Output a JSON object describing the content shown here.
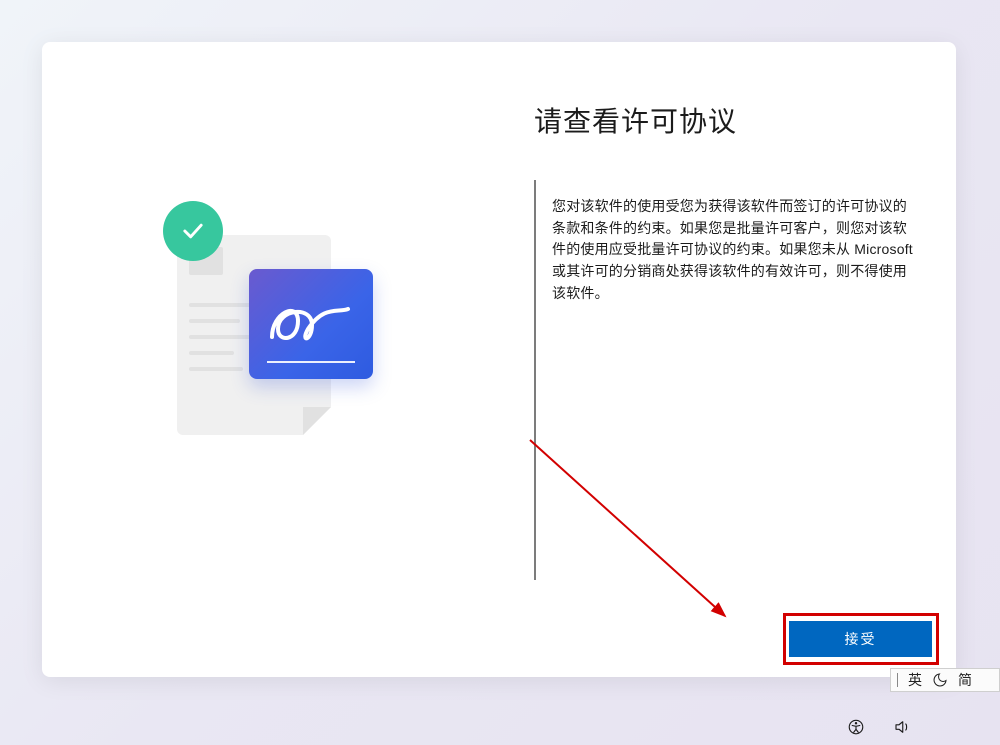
{
  "title": "请查看许可协议",
  "license_text": "您对该软件的使用受您为获得该软件而签订的许可协议的条款和条件的约束。如果您是批量许可客户，则您对该软件的使用应受批量许可协议的约束。如果您未从 Microsoft 或其许可的分销商处获得该软件的有效许可，则不得使用该软件。",
  "buttons": {
    "accept": "接受"
  },
  "ime": {
    "lang": "英",
    "mode": "简"
  },
  "colors": {
    "primary_button": "#0067c0",
    "highlight": "#d20000",
    "check_badge": "#37c79e"
  }
}
